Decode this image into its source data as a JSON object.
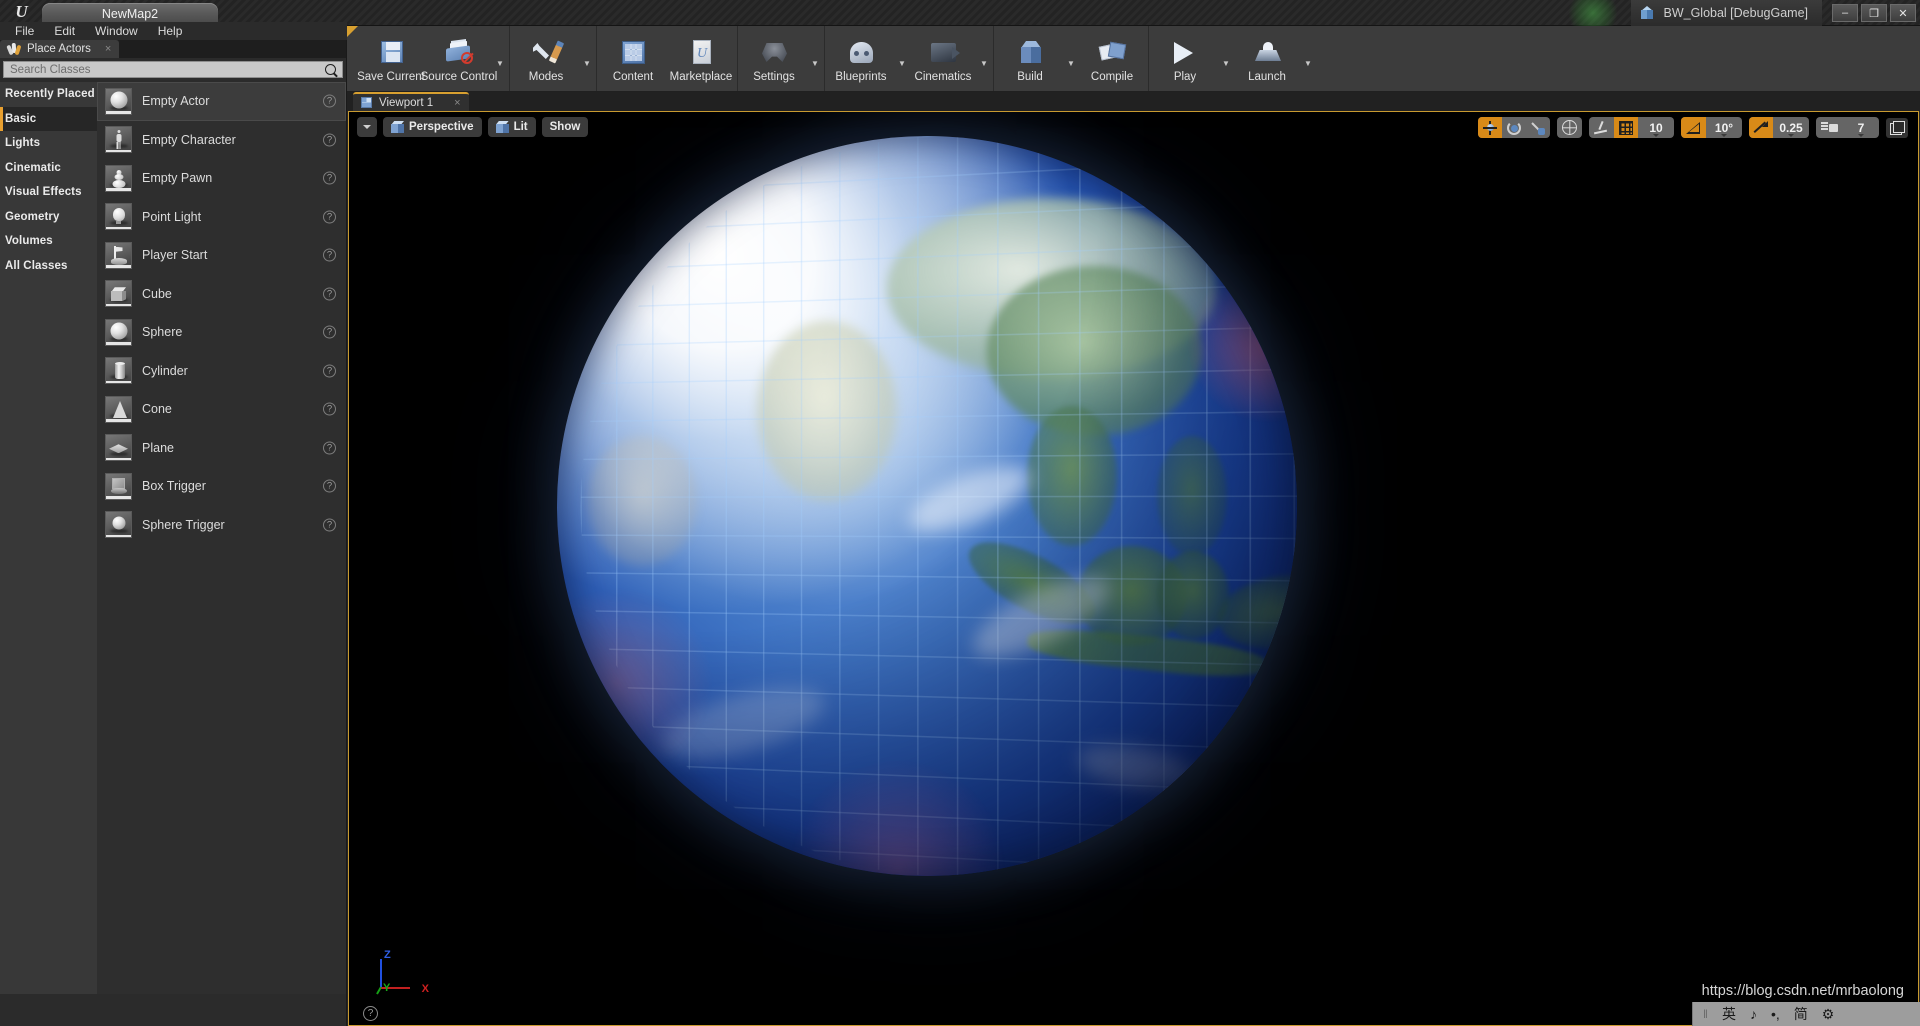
{
  "titlebar": {
    "logo": "ue-logo-icon",
    "project_tab": "NewMap2",
    "session_label": "BW_Global [DebugGame]",
    "session_icon": "blue-cube-icon",
    "minimize": "–",
    "maximize": "❐",
    "close": "✕"
  },
  "menubar": {
    "items": [
      {
        "label": "File"
      },
      {
        "label": "Edit"
      },
      {
        "label": "Window"
      },
      {
        "label": "Help"
      }
    ]
  },
  "place_actors": {
    "tab_label": "Place Actors",
    "tab_close": "×",
    "search": {
      "placeholder": "Search Classes",
      "value": "",
      "icon": "search-icon"
    },
    "categories": [
      {
        "label": "Recently Placed",
        "selected": false
      },
      {
        "label": "Basic",
        "selected": true
      },
      {
        "label": "Lights",
        "selected": false
      },
      {
        "label": "Cinematic",
        "selected": false
      },
      {
        "label": "Visual Effects",
        "selected": false
      },
      {
        "label": "Geometry",
        "selected": false
      },
      {
        "label": "Volumes",
        "selected": false
      },
      {
        "label": "All Classes",
        "selected": false
      }
    ],
    "actors": [
      {
        "label": "Empty Actor",
        "icon": "sphere-thumb-icon",
        "selected": true,
        "help": "?"
      },
      {
        "label": "Empty Character",
        "icon": "character-thumb-icon",
        "selected": false,
        "help": "?"
      },
      {
        "label": "Empty Pawn",
        "icon": "pawn-thumb-icon",
        "selected": false,
        "help": "?"
      },
      {
        "label": "Point Light",
        "icon": "lightbulb-thumb-icon",
        "selected": false,
        "help": "?"
      },
      {
        "label": "Player Start",
        "icon": "flag-thumb-icon",
        "selected": false,
        "help": "?"
      },
      {
        "label": "Cube",
        "icon": "cube-thumb-icon",
        "selected": false,
        "help": "?"
      },
      {
        "label": "Sphere",
        "icon": "sphere-thumb-icon",
        "selected": false,
        "help": "?"
      },
      {
        "label": "Cylinder",
        "icon": "cylinder-thumb-icon",
        "selected": false,
        "help": "?"
      },
      {
        "label": "Cone",
        "icon": "cone-thumb-icon",
        "selected": false,
        "help": "?"
      },
      {
        "label": "Plane",
        "icon": "plane-thumb-icon",
        "selected": false,
        "help": "?"
      },
      {
        "label": "Box Trigger",
        "icon": "box-trigger-thumb-icon",
        "selected": false,
        "help": "?"
      },
      {
        "label": "Sphere Trigger",
        "icon": "sphere-trigger-thumb-icon",
        "selected": false,
        "help": "?"
      }
    ]
  },
  "toolbar": {
    "groups": [
      {
        "buttons": [
          {
            "label": "Save Current",
            "icon": "save-icon",
            "dropdown": false
          },
          {
            "label": "Source Control",
            "icon": "source-control-disabled-icon",
            "dropdown": true
          }
        ]
      },
      {
        "buttons": [
          {
            "label": "Modes",
            "icon": "modes-wrench-pencil-icon",
            "dropdown": true
          }
        ]
      },
      {
        "buttons": [
          {
            "label": "Content",
            "icon": "content-browser-icon",
            "dropdown": false
          },
          {
            "label": "Marketplace",
            "icon": "marketplace-bag-icon",
            "dropdown": false
          }
        ]
      },
      {
        "buttons": [
          {
            "label": "Settings",
            "icon": "settings-gear-icon",
            "dropdown": true
          }
        ]
      },
      {
        "buttons": [
          {
            "label": "Blueprints",
            "icon": "blueprints-controller-icon",
            "dropdown": true
          },
          {
            "label": "Cinematics",
            "icon": "cinematics-clapper-icon",
            "dropdown": true
          }
        ]
      },
      {
        "buttons": [
          {
            "label": "Build",
            "icon": "build-cube-icon",
            "dropdown": true
          },
          {
            "label": "Compile",
            "icon": "compile-icon",
            "dropdown": false
          }
        ]
      },
      {
        "buttons": [
          {
            "label": "Play",
            "icon": "play-icon",
            "dropdown": true
          },
          {
            "label": "Launch",
            "icon": "launch-rocket-icon",
            "dropdown": true
          }
        ]
      }
    ]
  },
  "viewport": {
    "tab_label": "Viewport 1",
    "tab_close": "×",
    "tab_icon": "viewport-grid-icon",
    "controls": {
      "menu_caret": "▼",
      "view_mode": "Perspective",
      "view_mode_icon": "perspective-cube-icon",
      "lit": "Lit",
      "lit_icon": "lit-cube-icon",
      "show": "Show"
    },
    "snap": {
      "translate_icon": "move-gizmo-icon",
      "translate_active": true,
      "rotate_icon": "rotate-gizmo-icon",
      "rotate_active": false,
      "scale_icon": "scale-gizmo-icon",
      "scale_active": false,
      "coord_space_icon": "world-globe-icon",
      "surface_snap_icon": "surface-snap-icon",
      "grid_snap_icon": "grid-snap-icon",
      "grid_snap_active": true,
      "grid_value": "10",
      "angle_snap_icon": "angle-snap-icon",
      "angle_snap_active": true,
      "angle_value": "10°",
      "scale_snap_icon": "scale-snap-icon",
      "scale_snap_active": true,
      "scale_value": "0.25",
      "camera_speed_icon": "camera-speed-icon",
      "camera_speed_value": "7",
      "layout_icon": "viewport-layout-icon"
    },
    "gizmo": {
      "x": "X",
      "y": "Y",
      "z": "Z"
    },
    "help": "?"
  },
  "overlay": {
    "watermark": "https://blog.csdn.net/mrbaolong",
    "ime": {
      "divider": "‖",
      "lang": "英",
      "punct": "♪",
      "dot": "•,",
      "mode": "简",
      "settings": "⚙"
    }
  },
  "colors": {
    "accent_orange": "#d8a030",
    "panel_bg": "#2b2b2b",
    "toolbar_bg": "#3c3c3c",
    "viewport_bg": "#000000",
    "earth_blue": "#1d48a8"
  }
}
